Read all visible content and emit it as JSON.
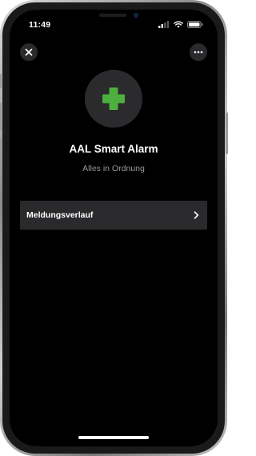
{
  "status_bar": {
    "time": "11:49"
  },
  "header": {
    "close_icon": "close-icon",
    "more_icon": "more-horizontal-icon"
  },
  "device": {
    "icon": "green-cross-icon",
    "icon_color": "#4caf3f",
    "name": "AAL Smart Alarm",
    "status": "Alles in Ordnung"
  },
  "menu": {
    "items": [
      {
        "label": "Meldungsverlauf",
        "icon": "chevron-right-icon"
      }
    ]
  },
  "colors": {
    "background": "#000000",
    "surface": "#2a2a2c",
    "secondary_text": "#9a9aa0",
    "accent": "#4caf3f"
  }
}
